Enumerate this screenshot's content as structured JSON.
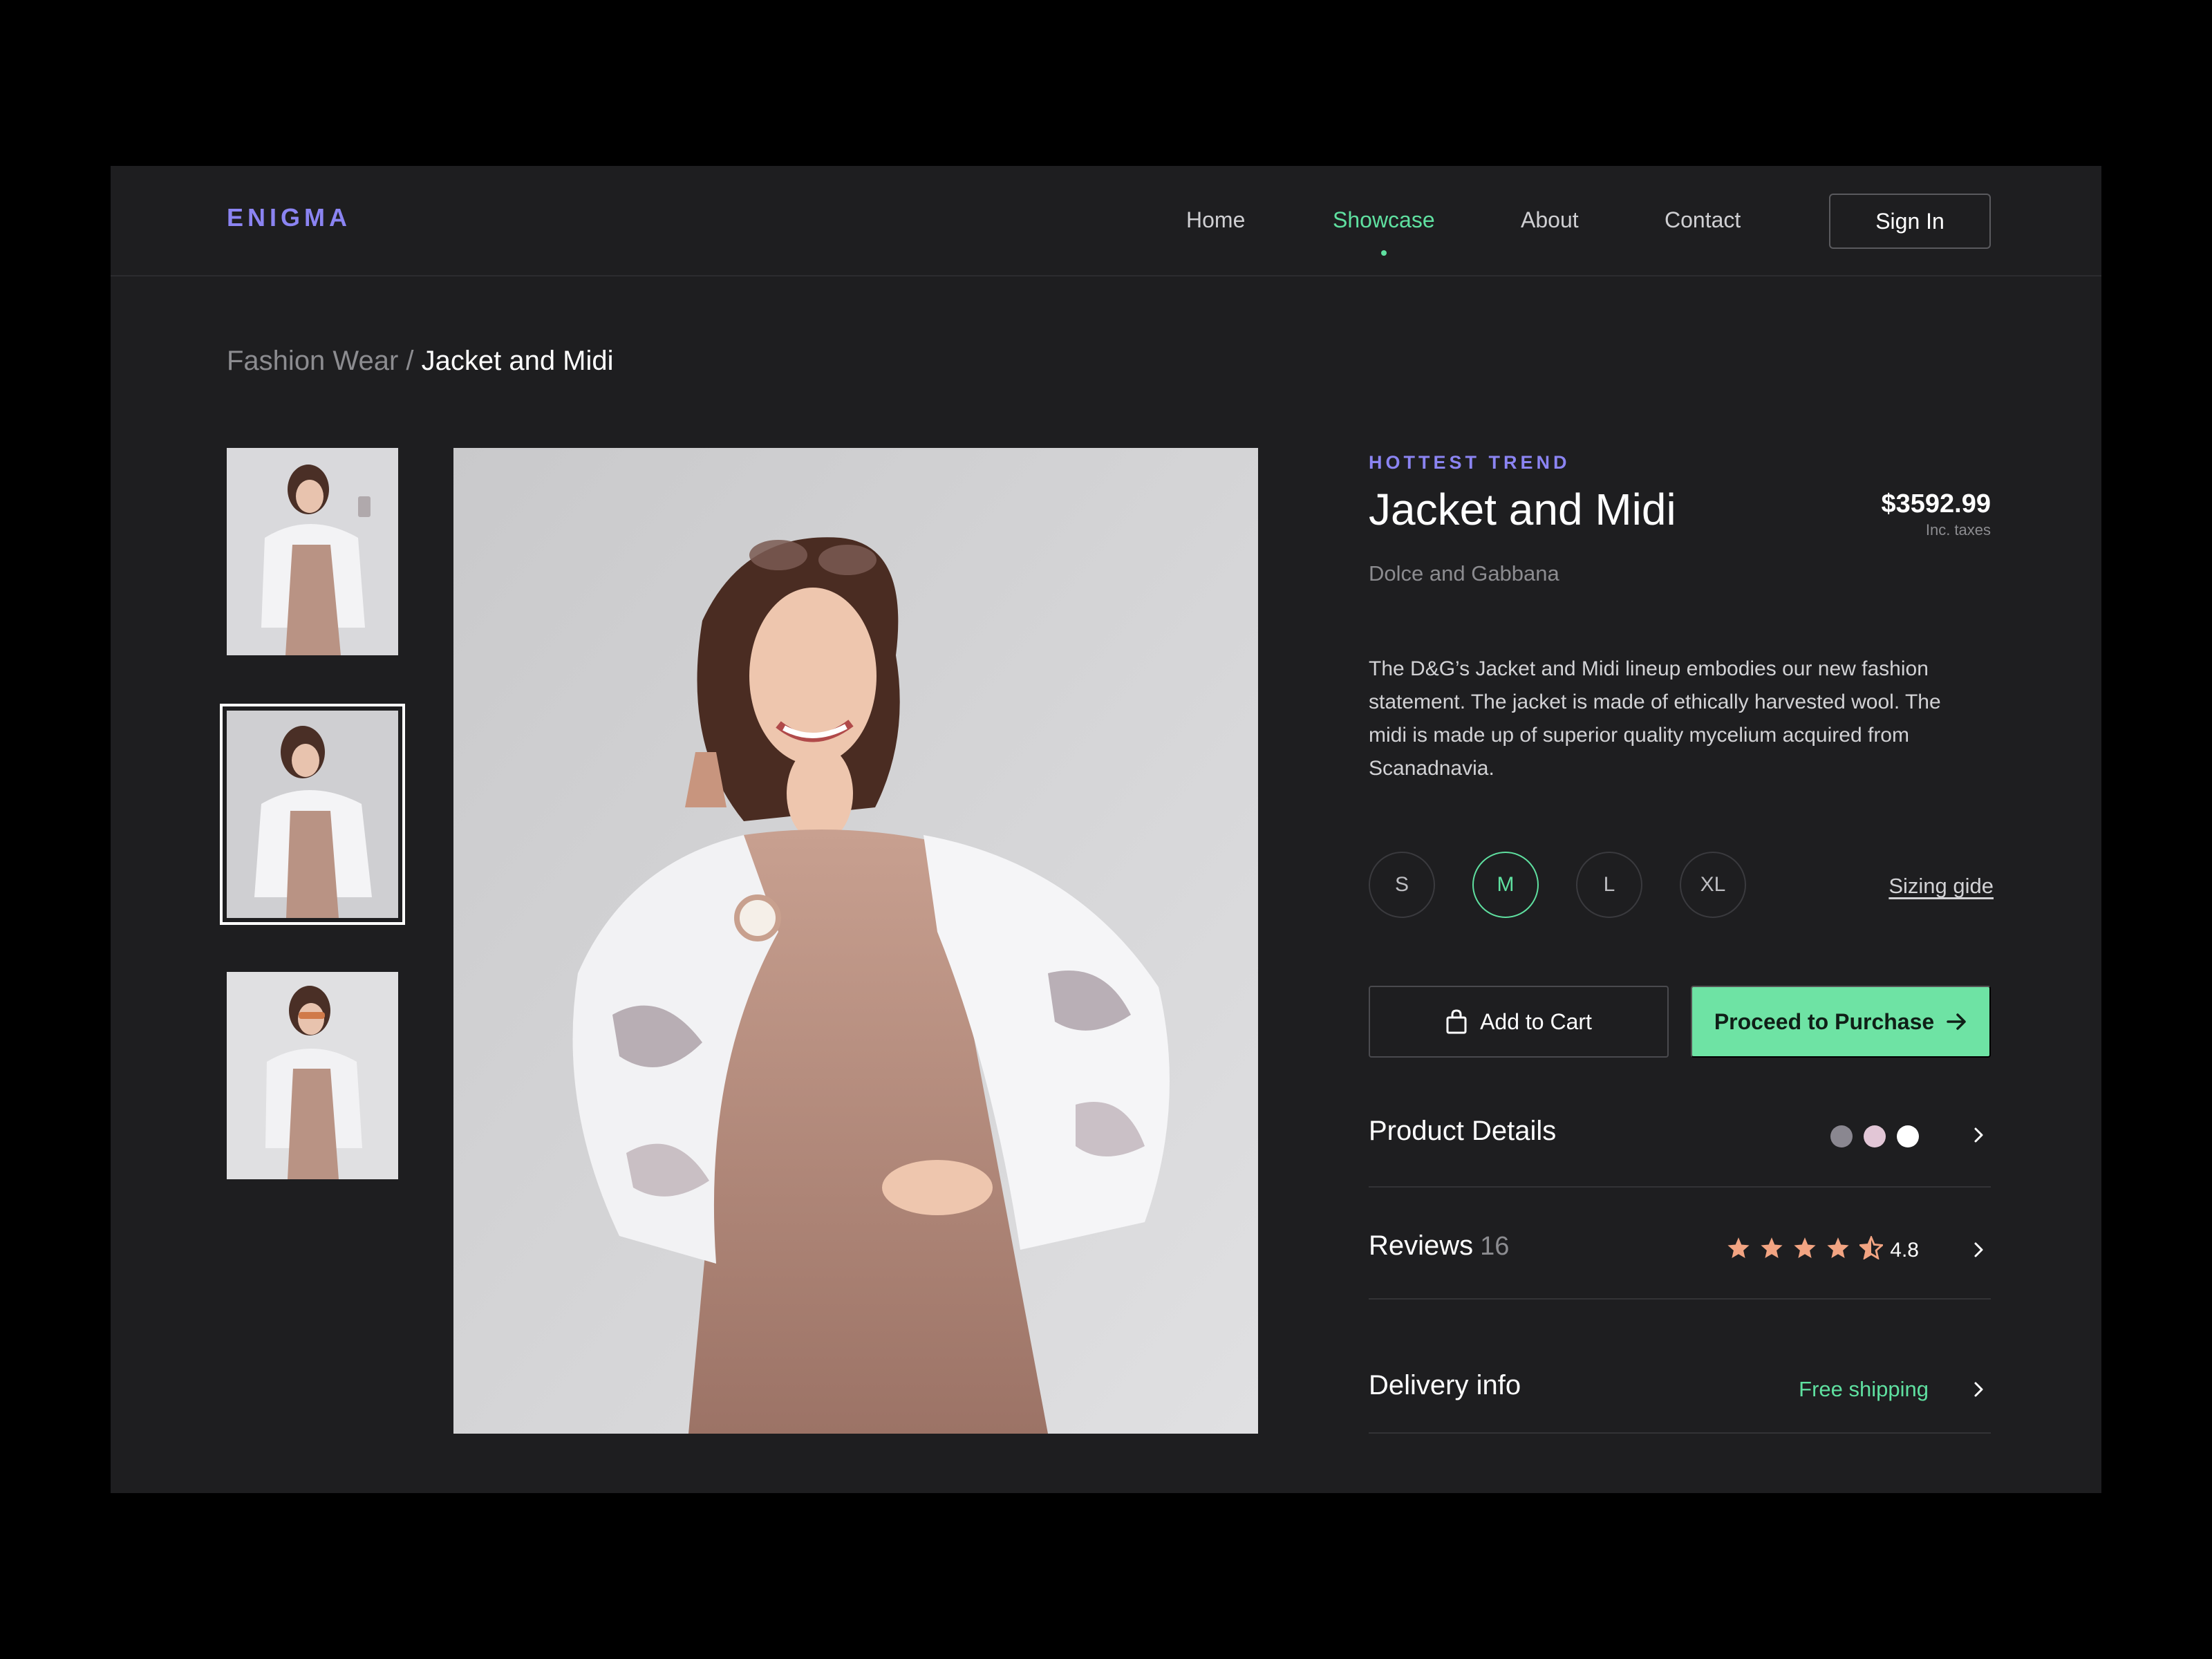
{
  "brand": {
    "logo": "ENIGMA"
  },
  "nav": {
    "items": [
      {
        "label": "Home"
      },
      {
        "label": "Showcase",
        "active": true
      },
      {
        "label": "About"
      },
      {
        "label": "Contact"
      }
    ],
    "signin_label": "Sign In"
  },
  "breadcrumb": {
    "parent": "Fashion Wear / ",
    "current": "Jacket and Midi"
  },
  "gallery": {
    "thumbnails": [
      {
        "icon": "photo-thumbnail-1",
        "selected": false
      },
      {
        "icon": "photo-thumbnail-2",
        "selected": true
      },
      {
        "icon": "photo-thumbnail-3",
        "selected": false
      }
    ]
  },
  "product": {
    "eyebrow": "HOTTEST TREND",
    "title": "Jacket and Midi",
    "price": "$3592.99",
    "price_note": "Inc. taxes",
    "brand": "Dolce and Gabbana",
    "description": "The D&G’s Jacket and Midi lineup embodies our new fashion statement. The jacket is made of ethically harvested wool. The midi is made up of superior quality mycelium acquired from Scanadnavia.",
    "sizes": [
      "S",
      "M",
      "L",
      "XL"
    ],
    "selected_size": "M",
    "sizing_guide": "Sizing gide"
  },
  "actions": {
    "add_to_cart": "Add to Cart",
    "purchase": "Proceed to Purchase"
  },
  "details": {
    "product_details": {
      "title": "Product Details",
      "swatches": [
        "#8a8790",
        "#e2c6d6",
        "#ffffff"
      ]
    },
    "reviews": {
      "title": "Reviews",
      "count": "16",
      "rating": "4.8",
      "stars": 4.5
    },
    "delivery": {
      "title": "Delivery info",
      "value": "Free shipping"
    }
  },
  "colors": {
    "accent_purple": "#8b84f2",
    "accent_green": "#5fe0a0",
    "button_green": "#6ee3a4",
    "star": "#f2a482",
    "background": "#1e1e20"
  }
}
